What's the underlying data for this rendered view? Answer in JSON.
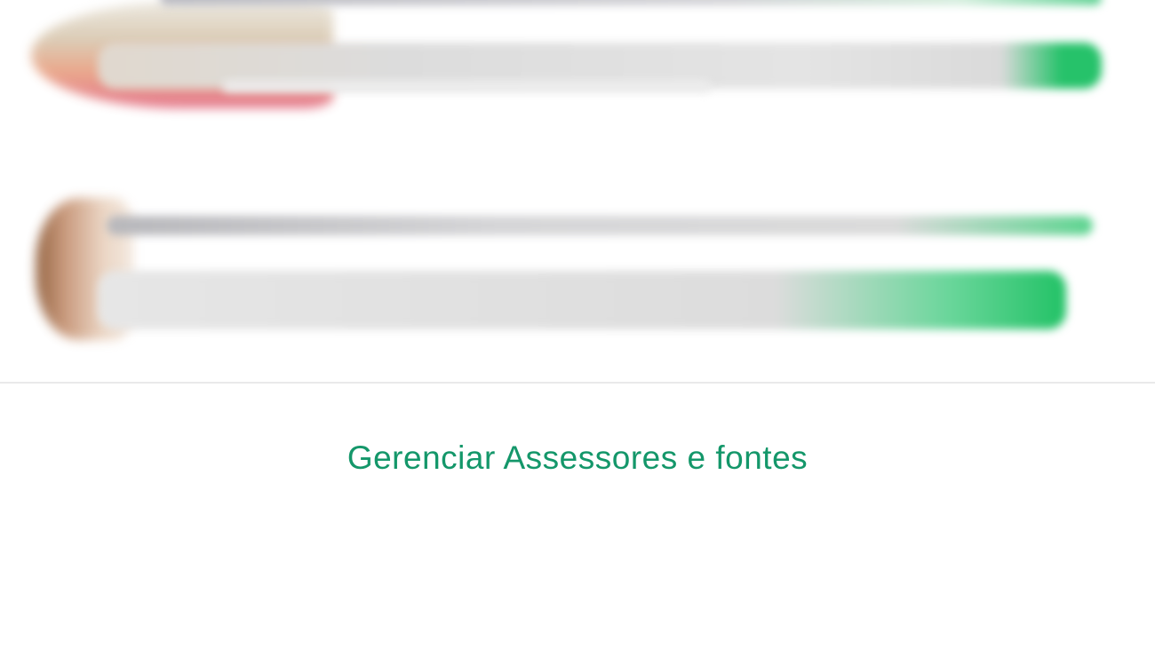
{
  "colors": {
    "accent": "#14976a",
    "background": "#ffffff",
    "divider": "#e9e9ea"
  },
  "footer": {
    "manage_link_label": "Gerenciar Assessores e fontes"
  }
}
